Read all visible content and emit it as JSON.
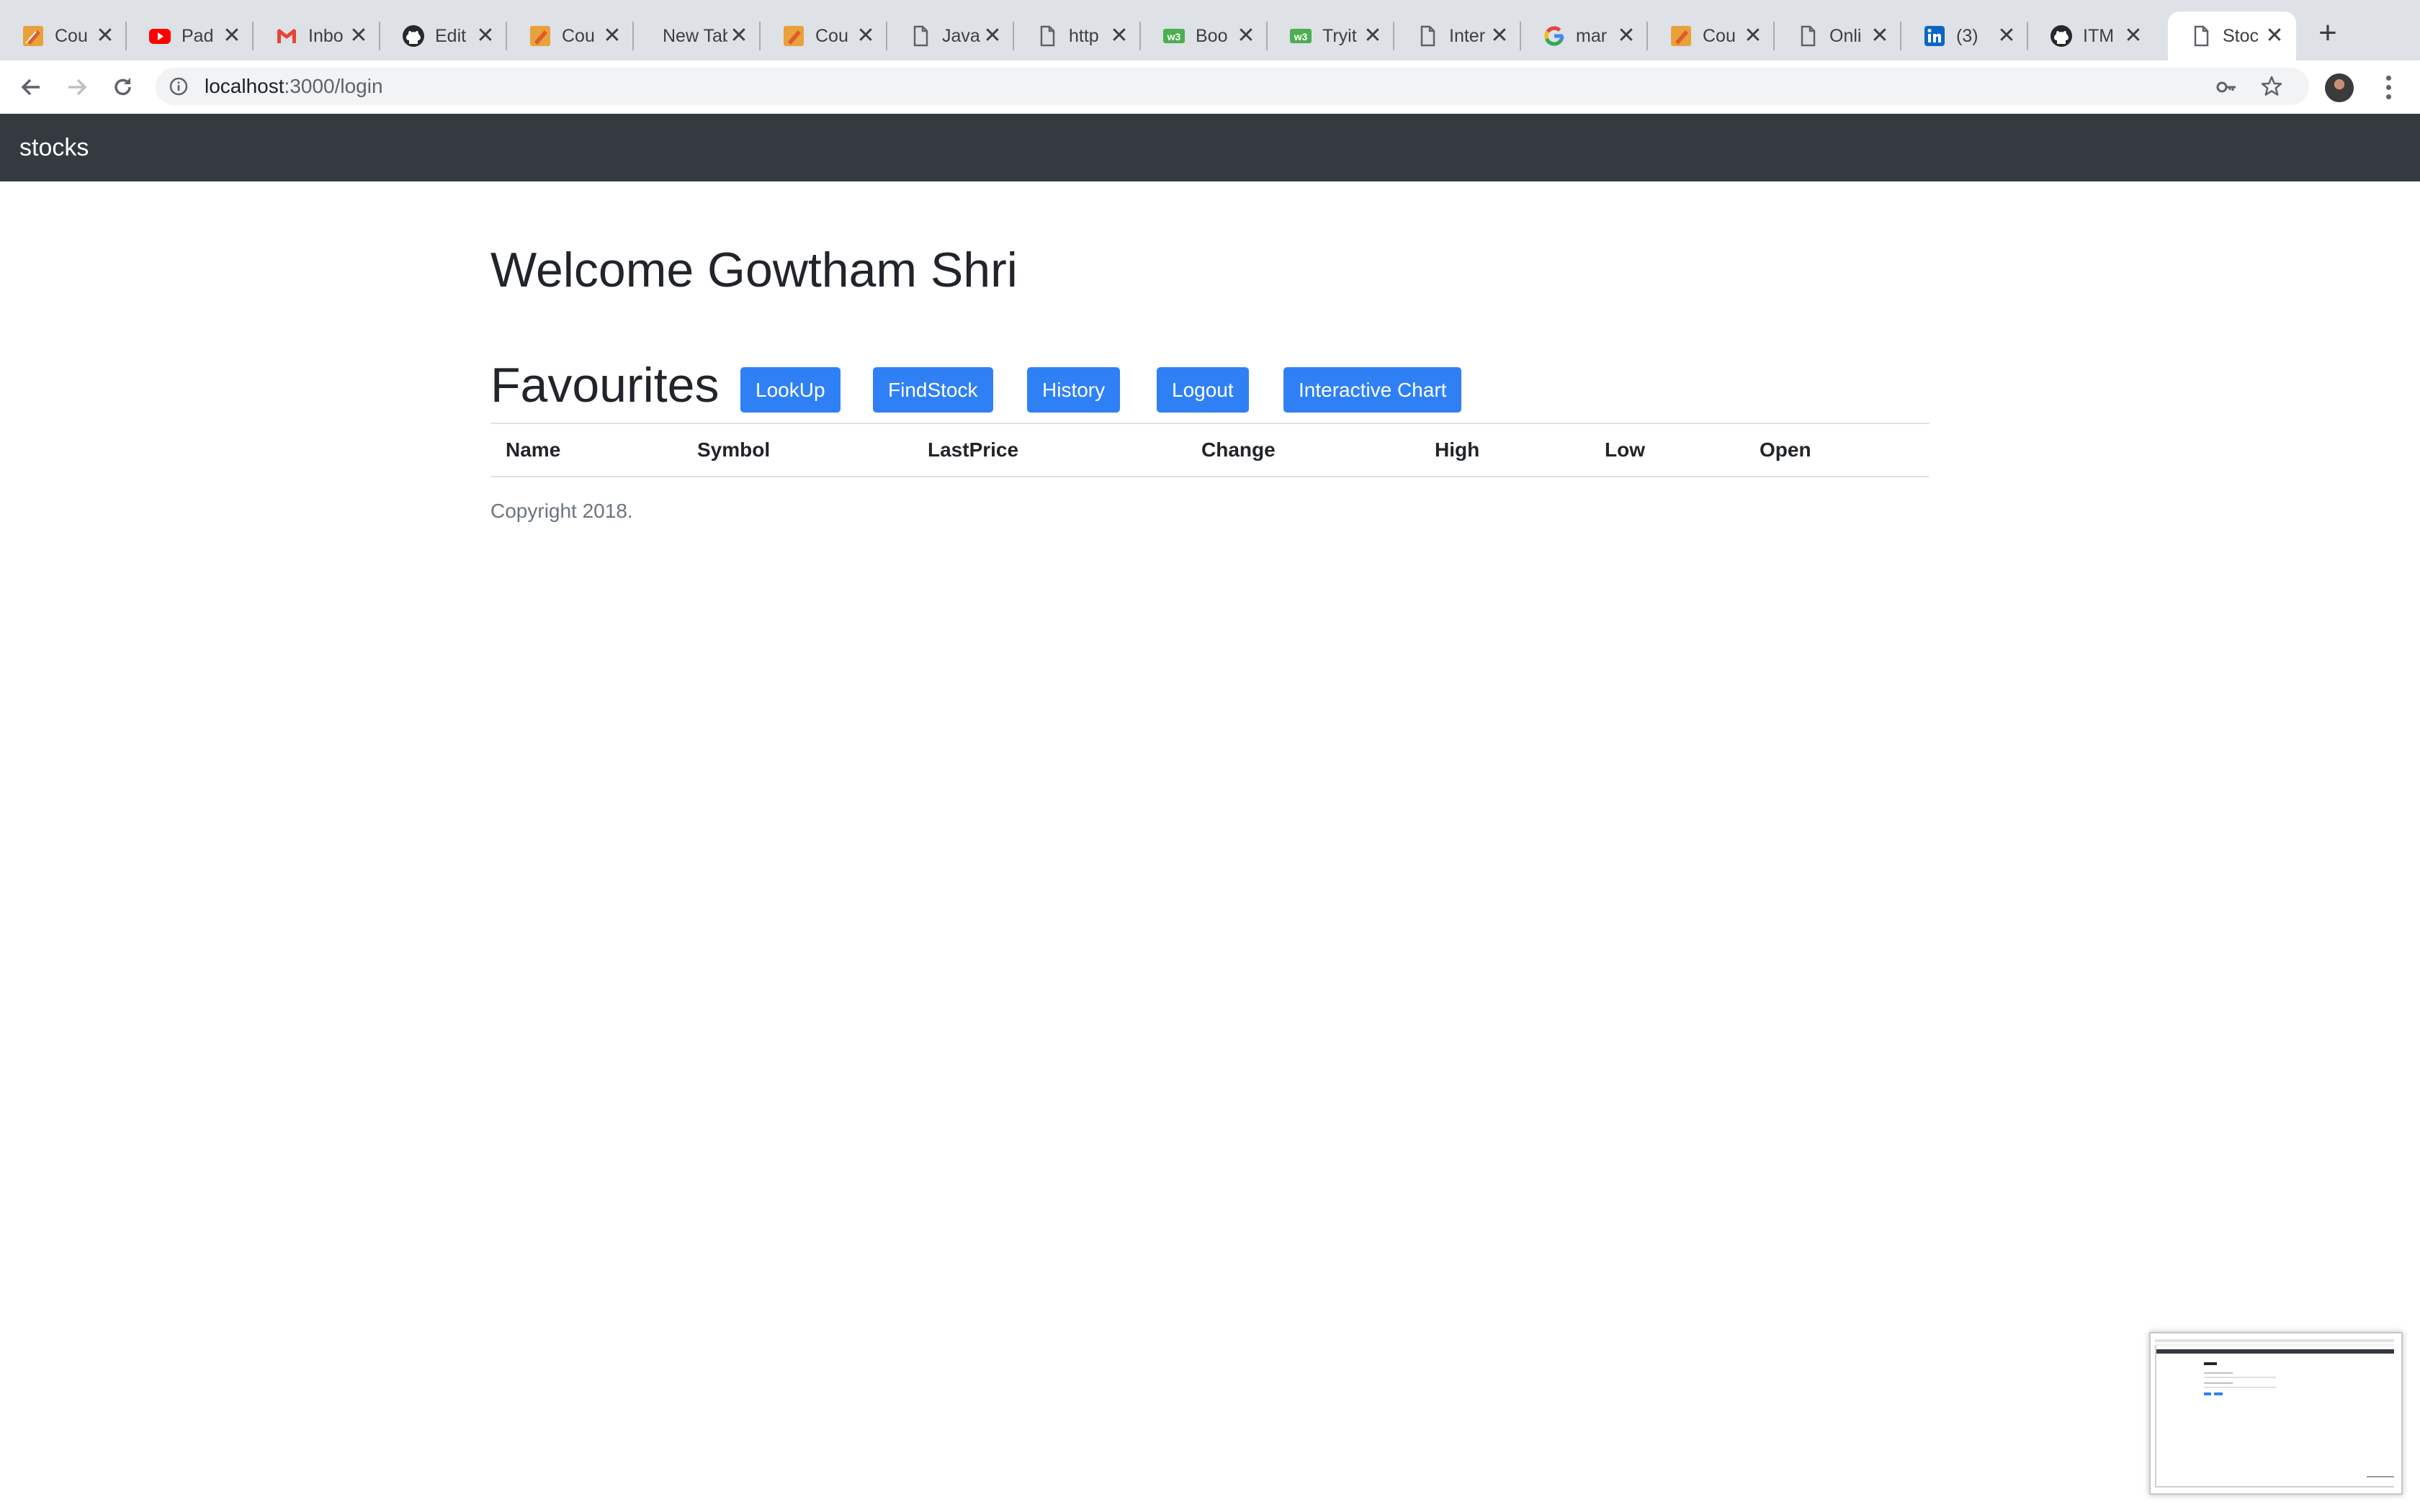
{
  "browser": {
    "tabs": [
      {
        "title": "Cou",
        "icon": "pencil-icon"
      },
      {
        "title": "Pad",
        "icon": "youtube-icon"
      },
      {
        "title": "Inbo",
        "icon": "gmail-icon"
      },
      {
        "title": "Edit",
        "icon": "github-icon"
      },
      {
        "title": "Cou",
        "icon": "pencil-icon"
      },
      {
        "title": "New Tab",
        "icon": ""
      },
      {
        "title": "Cou",
        "icon": "pencil-icon"
      },
      {
        "title": "Java",
        "icon": "page-icon"
      },
      {
        "title": "http",
        "icon": "page-icon"
      },
      {
        "title": "Boo",
        "icon": "w3-icon"
      },
      {
        "title": "Tryit",
        "icon": "w3-icon"
      },
      {
        "title": "Inter",
        "icon": "page-icon"
      },
      {
        "title": "mar",
        "icon": "google-icon"
      },
      {
        "title": "Cou",
        "icon": "pencil-icon"
      },
      {
        "title": "Onli",
        "icon": "page-icon"
      },
      {
        "title": "(3)",
        "icon": "linkedin-icon"
      },
      {
        "title": "ITM",
        "icon": "github-icon"
      },
      {
        "title": "Stoc",
        "icon": "page-icon"
      }
    ],
    "active_tab": 17,
    "url": {
      "host": "localhost",
      "path": ":3000/login"
    }
  },
  "navbar": {
    "brand": "stocks"
  },
  "page": {
    "welcome": "Welcome Gowtham Shri",
    "favourites_title": "Favourites",
    "buttons": {
      "lookup": "LookUp",
      "findstock": "FindStock",
      "history": "History",
      "logout": "Logout",
      "interactive_chart": "Interactive Chart"
    },
    "table_headers": [
      "Name",
      "Symbol",
      "LastPrice",
      "Change",
      "High",
      "Low",
      "Open"
    ],
    "copyright": "Copyright 2018."
  },
  "colors": {
    "navbar_bg": "#343a40",
    "button_primary": "#2f80f5",
    "tabstrip_bg": "#dee1e6"
  }
}
